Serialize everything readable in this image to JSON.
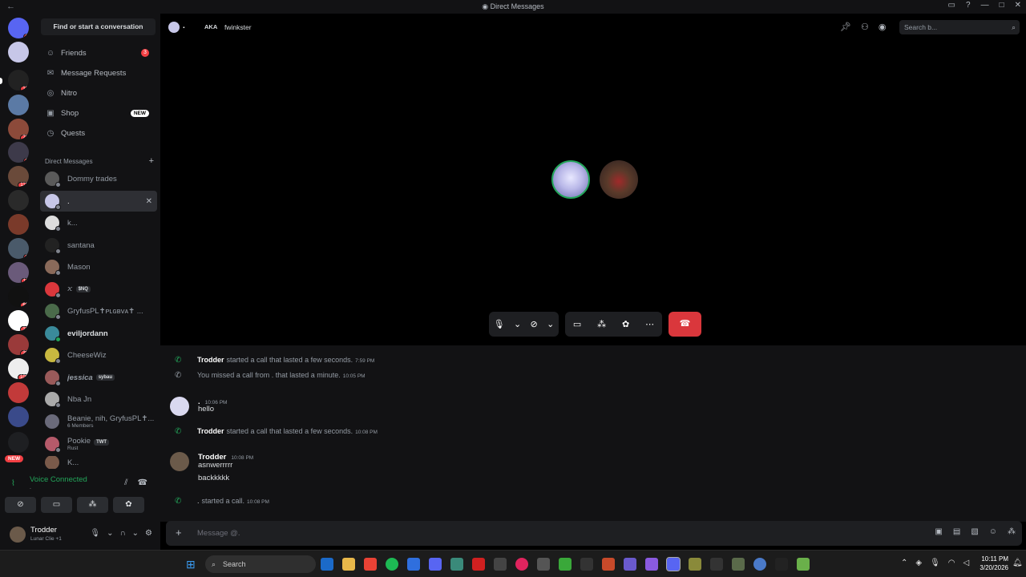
{
  "window": {
    "title": "Direct Messages",
    "back": "←",
    "controls": [
      "▭",
      "?",
      "—",
      "□",
      "✕"
    ]
  },
  "servers": [
    {
      "badge": "3"
    },
    {
      "badge": ""
    },
    {
      "badge": "12"
    },
    {
      "badge": ""
    },
    {
      "badge": "72"
    },
    {
      "badge": "6"
    },
    {
      "badge": "118"
    },
    {
      "badge": ""
    },
    {
      "badge": ""
    },
    {
      "badge": "6"
    },
    {
      "badge": "11"
    },
    {
      "badge": "60"
    },
    {
      "badge": "12"
    },
    {
      "badge": "20"
    },
    {
      "badge": "105"
    },
    {
      "badge": ""
    },
    {
      "badge": ""
    },
    {
      "badge": ""
    }
  ],
  "servers_new_label": "NEW",
  "sidebar": {
    "find": "Find or start a conversation",
    "nav": [
      {
        "label": "Friends",
        "count": "3",
        "icon": "friends-icon"
      },
      {
        "label": "Message Requests",
        "icon": "mail-icon"
      },
      {
        "label": "Nitro",
        "icon": "nitro-icon"
      },
      {
        "label": "Shop",
        "tag": "NEW",
        "icon": "shop-icon"
      },
      {
        "label": "Quests",
        "icon": "quests-icon"
      }
    ],
    "dm_header": "Direct Messages",
    "dm_plus": "+",
    "dms": [
      {
        "name": "Dommy trades",
        "sub": "",
        "tag": ""
      },
      {
        "name": ".",
        "sub": "",
        "tag": ""
      },
      {
        "name": "k...",
        "sub": "",
        "tag": ""
      },
      {
        "name": "santana",
        "sub": "",
        "tag": ""
      },
      {
        "name": "Mason",
        "sub": "",
        "tag": ""
      },
      {
        "name": "ꪎ",
        "sub": "",
        "tag": "$NQ"
      },
      {
        "name": "GryfusPL✝ᴘʟɢʙᴠᴀ✝ ...",
        "sub": "",
        "tag": ""
      },
      {
        "name": "eviljordann",
        "sub": "",
        "tag": ""
      },
      {
        "name": "CheeseWiz",
        "sub": "",
        "tag": ""
      },
      {
        "name": "jessica",
        "sub": "",
        "tag": "sybau"
      },
      {
        "name": "Nba Jn",
        "sub": "",
        "tag": ""
      },
      {
        "name": "Beanie, nih, GryfusPL✝...",
        "sub": "6 Members",
        "tag": ""
      },
      {
        "name": "Pookie",
        "sub": "Rust",
        "tag": "TWT"
      },
      {
        "name": "K...",
        "sub": "",
        "tag": ""
      }
    ],
    "close_glyph": "✕"
  },
  "voice": {
    "label": "Voice Connected",
    "sub": "."
  },
  "user": {
    "name": "Trodder",
    "status": "Lunar Clie +1"
  },
  "header": {
    "name": ".",
    "aka": "AKA",
    "alias": "fwinkster",
    "search_placeholder": "Search b..."
  },
  "chat": {
    "events": [
      {
        "user": "Trodder",
        "text": "started a call that lasted a few seconds.",
        "time": "7:59 PM",
        "missed": false
      },
      {
        "user": "",
        "text": "You missed a call from . that lasted a minute.",
        "time": "10:05 PM",
        "missed": true
      },
      {
        "user": "Trodder",
        "text": "started a call that lasted a few seconds.",
        "time": "10:08 PM",
        "missed": false
      },
      {
        "user": ".",
        "text": "started a call.",
        "time": "10:08 PM",
        "missed": false
      }
    ],
    "messages": [
      {
        "user": ".",
        "time": "10:06 PM",
        "lines": [
          "hello"
        ]
      },
      {
        "user": "Trodder",
        "time": "10:08 PM",
        "lines": [
          "asnwerrrrr",
          "backkkkk"
        ]
      }
    ]
  },
  "composer": {
    "placeholder": "Message @."
  },
  "taskbar": {
    "search": "Search",
    "time": "10:11 PM",
    "date": "3/20/2026"
  },
  "colors": {
    "accent": "#5865f2",
    "green": "#23a55a",
    "red": "#da373c",
    "bg": "#000000"
  }
}
